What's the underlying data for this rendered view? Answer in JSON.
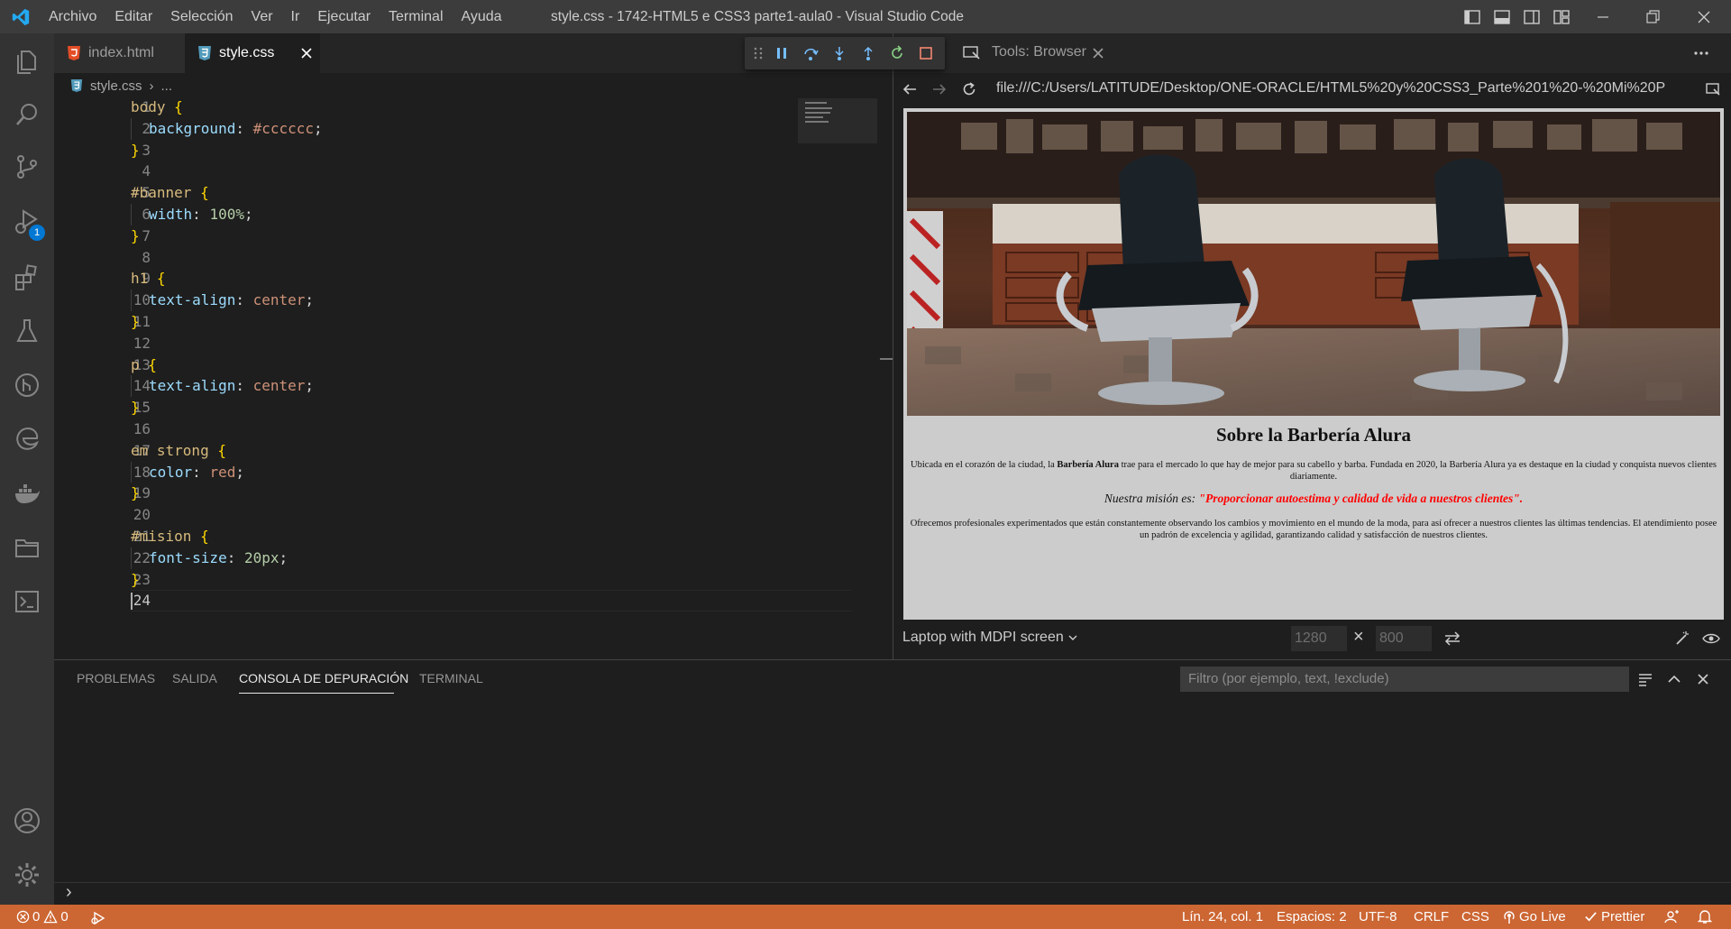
{
  "window": {
    "title": "style.css - 1742-HTML5 e CSS3 parte1-aula0 - Visual Studio Code",
    "menu": [
      "Archivo",
      "Editar",
      "Selección",
      "Ver",
      "Ir",
      "Ejecutar",
      "Terminal",
      "Ayuda"
    ]
  },
  "colors": {
    "accent": "#0078d4",
    "statusbar": "#cc6633",
    "html_icon": "#e44d26",
    "css_icon": "#519aba"
  },
  "activity": {
    "debug_badge": "1"
  },
  "tabs": [
    {
      "label": "index.html",
      "icon": "html5-file-icon",
      "active": false
    },
    {
      "label": "style.css",
      "icon": "css-file-icon",
      "active": true
    }
  ],
  "breadcrumb": {
    "file": "style.css",
    "separator": "›",
    "rest": "..."
  },
  "editor": {
    "line_numbers": [
      "1",
      "2",
      "3",
      "4",
      "5",
      "6",
      "7",
      "8",
      "9",
      "10",
      "11",
      "12",
      "13",
      "14",
      "15",
      "16",
      "17",
      "18",
      "19",
      "20",
      "21",
      "22",
      "23",
      "24"
    ],
    "code": [
      {
        "selector": "body",
        "open": " {"
      },
      {
        "prop": "background",
        "value": "#cccccc",
        "vclass": "val"
      },
      {
        "close": "}"
      },
      {},
      {
        "selector": "#banner",
        "open": " {"
      },
      {
        "prop": "width",
        "value": "100%",
        "vclass": "num"
      },
      {
        "close": "}"
      },
      {},
      {
        "selector": "h1",
        "open": " {"
      },
      {
        "prop": "text-align",
        "value": "center",
        "vclass": "val"
      },
      {
        "close": "}"
      },
      {},
      {
        "selector": "p",
        "open": " {"
      },
      {
        "prop": "text-align",
        "value": "center",
        "vclass": "val"
      },
      {
        "close": "}"
      },
      {},
      {
        "selector": "em strong",
        "open": " {"
      },
      {
        "prop": "color",
        "value": "red",
        "vclass": "val"
      },
      {
        "close": "}"
      },
      {},
      {
        "selector": "#mision",
        "open": " {"
      },
      {
        "prop": "font-size",
        "value": "20px",
        "vclass": "num"
      },
      {
        "close": "}"
      },
      {}
    ]
  },
  "browser": {
    "tab_label": "Tools: Browser",
    "url": "file:///C:/Users/LATITUDE/Desktop/ONE-ORACLE/HTML5%20y%20CSS3_Parte%201%20-%20Mi%20P",
    "device": "Laptop with MDPI screen",
    "width": "1280",
    "height": "800",
    "times": "×",
    "page": {
      "h1": "Sobre la Barbería Alura",
      "p1_a": "Ubicada en el corazón de la ciudad, la ",
      "p1_b": "Barbería Alura",
      "p1_c": " trae para el mercado lo que hay de mejor para su cabello y barba. Fundada en 2020, la Barbería Alura ya es destaque en la ciudad y conquista nuevos clientes diariamente.",
      "mision_a": "Nuestra misión es: ",
      "mision_b": "\"Proporcionar autoestima y calidad de vida a nuestros clientes\".",
      "p3": "Ofrecemos profesionales experimentados que están constantemente observando los cambios y movimiento en el mundo de la moda, para así ofrecer a nuestros clientes las últimas tendencias. El atendimiento posee un padrón de excelencia y agilidad, garantizando calidad y satisfacción de nuestros clientes."
    }
  },
  "panel": {
    "tabs": [
      "PROBLEMAS",
      "SALIDA",
      "CONSOLA DE DEPURACIÓN",
      "TERMINAL"
    ],
    "active_tab": "CONSOLA DE DEPURACIÓN",
    "filter_placeholder": "Filtro (por ejemplo, text, !exclude)",
    "prompt": "›"
  },
  "status": {
    "errors": "0",
    "warnings": "0",
    "position": "Lín. 24, col. 1",
    "spaces": "Espacios: 2",
    "encoding": "UTF-8",
    "eol": "CRLF",
    "language": "CSS",
    "golive": "Go Live",
    "prettier": "Prettier"
  }
}
